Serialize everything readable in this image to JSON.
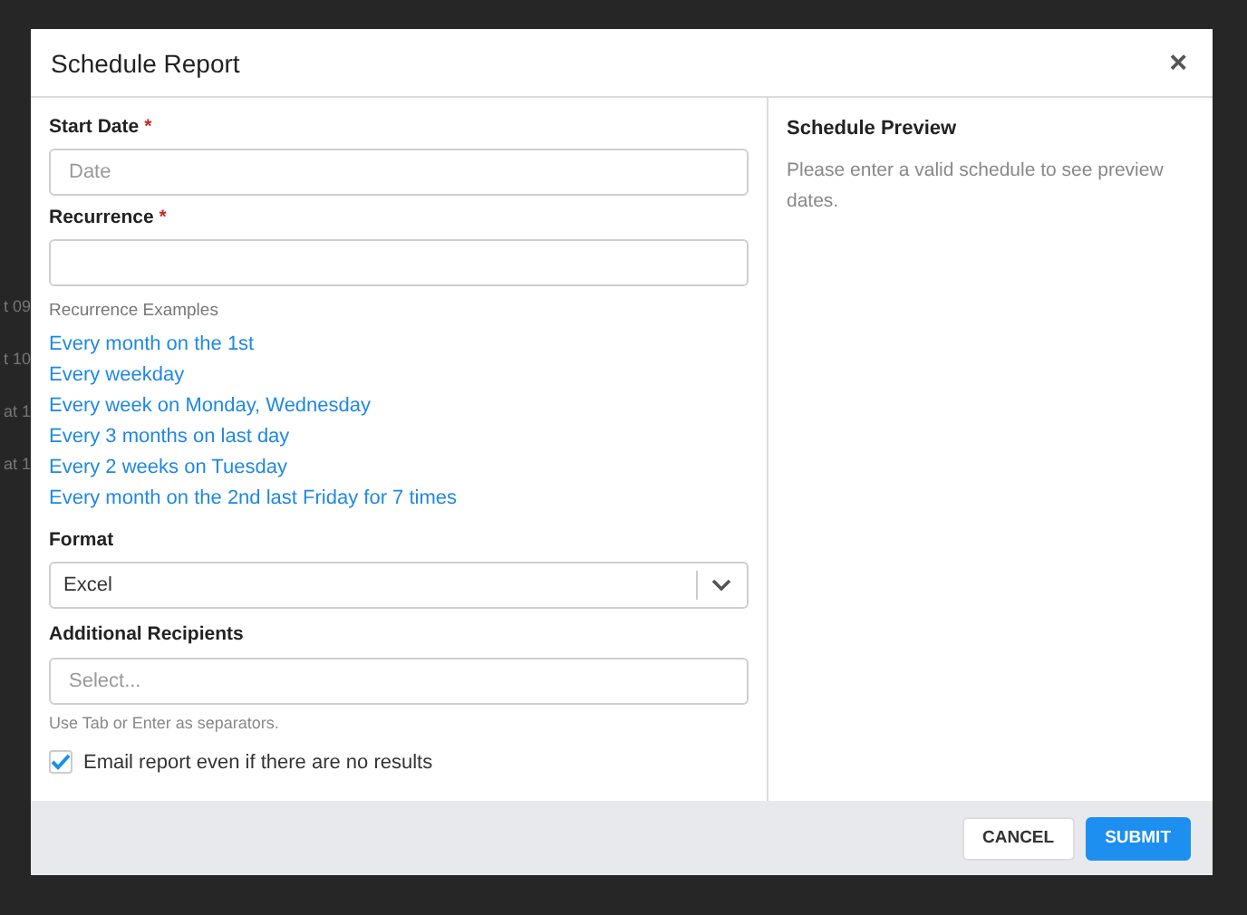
{
  "background_rows": [
    "t 09",
    "t 10",
    "at 1",
    "at 1"
  ],
  "dialog": {
    "title": "Schedule Report",
    "close": "×"
  },
  "fields": [
    {
      "kind": "input",
      "label": "Start Date",
      "required_mark": "*",
      "placeholder": "Date"
    },
    {
      "kind": "input",
      "label": "Recurrence",
      "required_mark": "*"
    }
  ],
  "examples": {
    "heading": "Recurrence Examples",
    "links": [
      "Every month on the 1st",
      "Every weekday",
      "Every week on Monday, Wednesday",
      "Every 3 months on last day",
      "Every 2 weeks on Tuesday",
      "Every month on the 2nd last Friday for 7 times"
    ]
  },
  "format": {
    "label": "Format",
    "value": "Excel"
  },
  "recipients": {
    "label": "Additional Recipients",
    "placeholder": "Select...",
    "hint": "Use Tab or Enter as separators."
  },
  "email_option": {
    "label": "Email report even if there are no results",
    "checked": true
  },
  "preview": {
    "title": "Schedule Preview",
    "message": "Please enter a valid schedule to see preview dates."
  },
  "buttons": [
    {
      "label": "CANCEL",
      "kind": "secondary"
    },
    {
      "label": "SUBMIT",
      "kind": "primary"
    }
  ]
}
